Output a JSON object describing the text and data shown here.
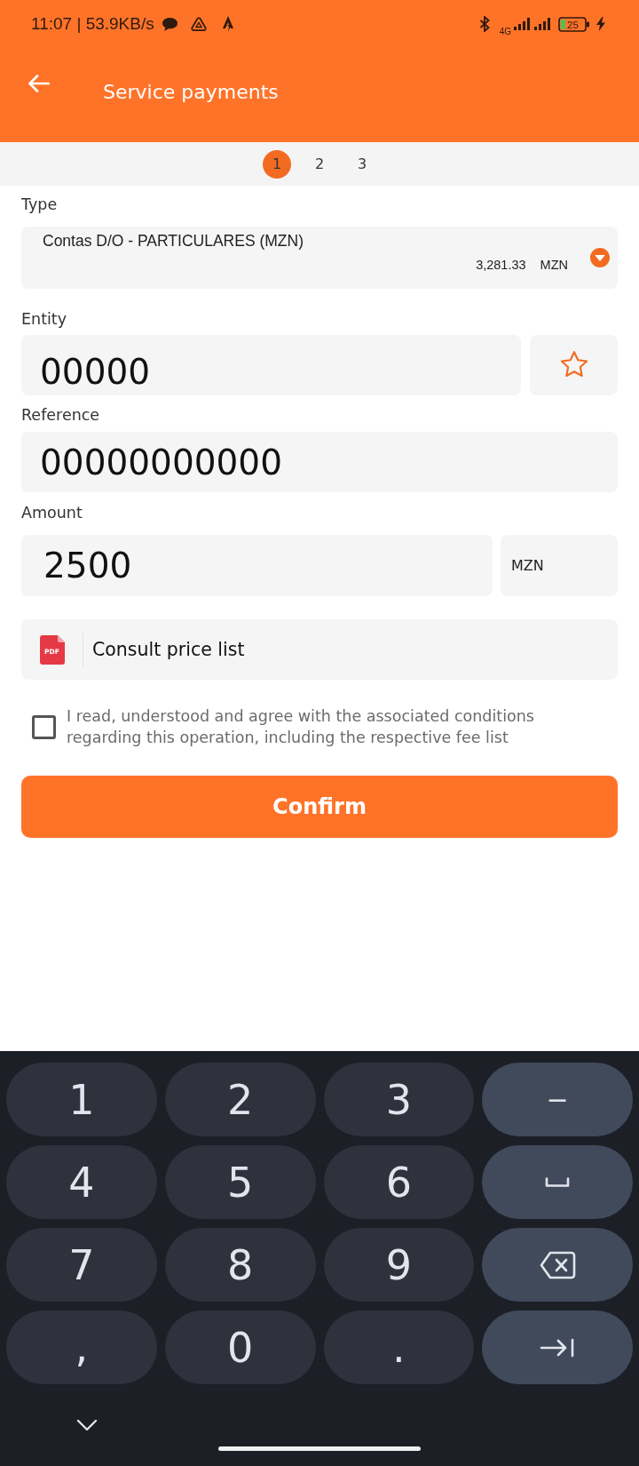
{
  "status_bar": {
    "time_speed": "11:07 | 53.9KB/s",
    "network": "4G",
    "battery": "25",
    "charging": true
  },
  "header": {
    "title": "Service payments"
  },
  "stepper": [
    {
      "label": "1",
      "selected": true
    },
    {
      "label": "2",
      "selected": false
    },
    {
      "label": "3",
      "selected": false
    }
  ],
  "form": {
    "type": {
      "label": "Type",
      "account": "Contas D/O - PARTICULARES (MZN)",
      "balance": "3,281.33",
      "currency": "MZN"
    },
    "entity": {
      "label": "Entity",
      "value": "00000",
      "favorite": false
    },
    "reference": {
      "label": "Reference",
      "value": "00000000000"
    },
    "amount": {
      "label": "Amount",
      "value": "2500",
      "currency": "MZN"
    },
    "price_list": {
      "label": "Consult price list",
      "file_type": "PDF"
    },
    "terms": {
      "text": "I read, understood and agree with the associated conditions regarding this operation, including the respective fee list",
      "checked": false
    },
    "confirm": {
      "label": "Confirm"
    }
  },
  "keyboard": {
    "rows": [
      [
        {
          "kind": "char",
          "label": "1"
        },
        {
          "kind": "char",
          "label": "2"
        },
        {
          "kind": "char",
          "label": "3"
        },
        {
          "kind": "symbol",
          "label": "−"
        }
      ],
      [
        {
          "kind": "char",
          "label": "4"
        },
        {
          "kind": "char",
          "label": "5"
        },
        {
          "kind": "char",
          "label": "6"
        },
        {
          "kind": "space"
        }
      ],
      [
        {
          "kind": "char",
          "label": "7"
        },
        {
          "kind": "char",
          "label": "8"
        },
        {
          "kind": "char",
          "label": "9"
        },
        {
          "kind": "backspace"
        }
      ],
      [
        {
          "kind": "char",
          "label": ","
        },
        {
          "kind": "char",
          "label": "0"
        },
        {
          "kind": "char",
          "label": "."
        },
        {
          "kind": "next"
        }
      ]
    ]
  }
}
